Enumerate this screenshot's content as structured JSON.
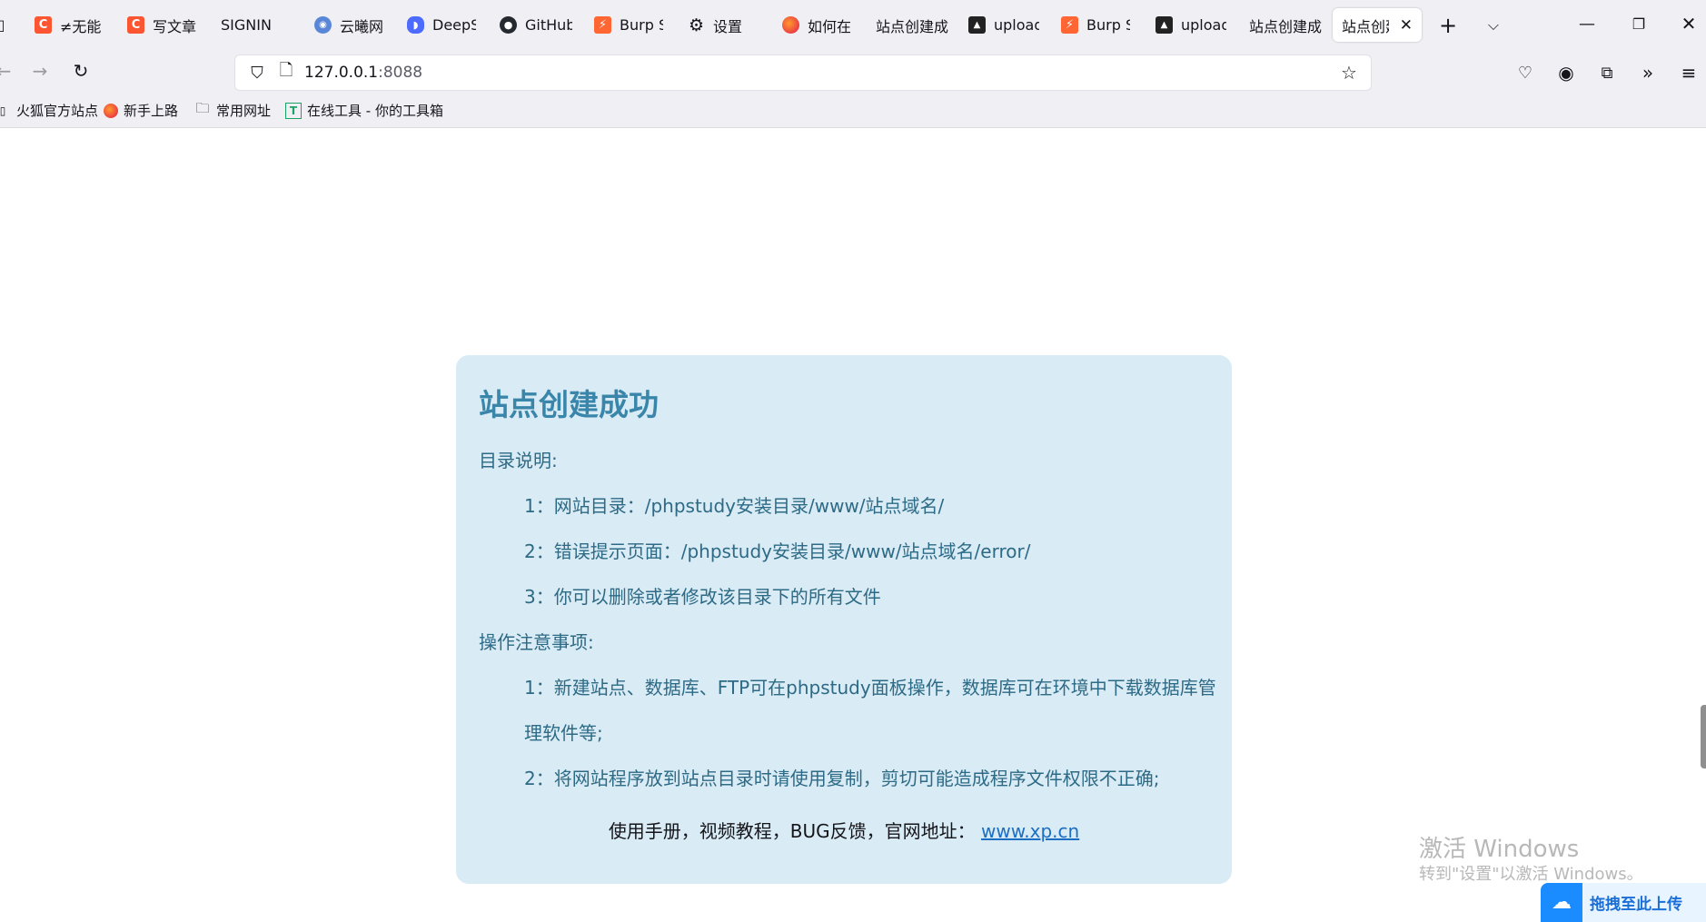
{
  "browser": {
    "tabs": [
      {
        "label": "≠无能",
        "icon": "csdn-icon"
      },
      {
        "label": "写文章",
        "icon": "csdn-icon"
      },
      {
        "label": "SIGNIN",
        "icon": ""
      },
      {
        "label": "云曦网",
        "icon": "globe-icon"
      },
      {
        "label": "DeepS",
        "icon": "deepseek-icon"
      },
      {
        "label": "GitHub",
        "icon": "github-icon"
      },
      {
        "label": "Burp S",
        "icon": "burp-icon"
      },
      {
        "label": "设置",
        "icon": "gear-icon"
      },
      {
        "label": "如何在",
        "icon": "firefox-icon"
      },
      {
        "label": "站点创建成",
        "icon": ""
      },
      {
        "label": "upload",
        "icon": "upload-labs-icon"
      },
      {
        "label": "Burp S",
        "icon": "burp-icon"
      },
      {
        "label": "upload",
        "icon": "upload-labs-icon"
      },
      {
        "label": "站点创建成",
        "icon": ""
      },
      {
        "label": "站点创建",
        "icon": "",
        "active": true
      }
    ],
    "url_host": "127.0.0.1",
    "url_port": ":8088",
    "bookmarks": [
      {
        "label": "火狐官方站点",
        "icon": "firefox-bookmark-icon"
      },
      {
        "label": "新手上路",
        "icon": "firefox-icon"
      },
      {
        "label": "常用网址",
        "icon": "folder-icon"
      },
      {
        "label": "在线工具 - 你的工具箱",
        "icon": "tool-icon"
      }
    ]
  },
  "page": {
    "title": "站点创建成功",
    "dir_heading": "目录说明:",
    "dir_items": [
      "1：网站目录：/phpstudy安装目录/www/站点域名/",
      "2：错误提示页面：/phpstudy安装目录/www/站点域名/error/",
      "3：你可以删除或者修改该目录下的所有文件"
    ],
    "ops_heading": "操作注意事项:",
    "ops_items": [
      "1：新建站点、数据库、FTP可在phpstudy面板操作，数据库可在环境中下载数据库管",
      "理软件等;",
      "2：将网站程序放到站点目录时请使用复制，剪切可能造成程序文件权限不正确;"
    ],
    "footer_text": "使用手册，视频教程，BUG反馈，官网地址：",
    "footer_link": "www.xp.cn"
  },
  "overlay": {
    "watermark_title": "激活 Windows",
    "watermark_sub": "转到\"设置\"以激活 Windows。",
    "upload_label": "拖拽至此上传"
  },
  "colors": {
    "card_bg": "#d9ebf4",
    "title": "#3a86aa",
    "text": "#2d6a86",
    "link": "#1b6ec2"
  }
}
